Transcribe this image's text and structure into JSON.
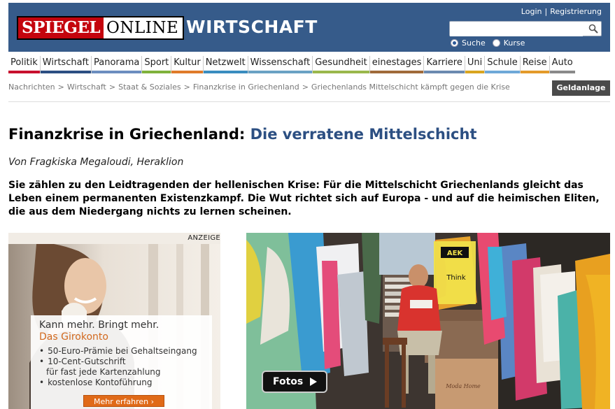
{
  "header": {
    "logo_word1": "SPIEGEL",
    "logo_word2": "ONLINE",
    "section": "WIRTSCHAFT",
    "login": "Login",
    "separator": "|",
    "register": "Registrierung",
    "search_placeholder": "",
    "radio_suche": "Suche",
    "radio_kurse": "Kurse"
  },
  "nav": [
    {
      "label": "Politik",
      "color": "#c8102e"
    },
    {
      "label": "Wirtschaft",
      "color": "#2c4f82"
    },
    {
      "label": "Panorama",
      "color": "#6c8ebf"
    },
    {
      "label": "Sport",
      "color": "#7fb23c"
    },
    {
      "label": "Kultur",
      "color": "#e07b2a"
    },
    {
      "label": "Netzwelt",
      "color": "#3a8dbf"
    },
    {
      "label": "Wissenschaft",
      "color": "#6aa2c4"
    },
    {
      "label": "Gesundheit",
      "color": "#9ab84c"
    },
    {
      "label": "einestages",
      "color": "#a06a3a"
    },
    {
      "label": "Karriere",
      "color": "#6b8ab0"
    },
    {
      "label": "Uni",
      "color": "#d9a520"
    },
    {
      "label": "Schule",
      "color": "#6ea8d8"
    },
    {
      "label": "Reise",
      "color": "#e39a2a"
    },
    {
      "label": "Auto",
      "color": "#8a8a8a"
    }
  ],
  "breadcrumb": [
    "Nachrichten",
    "Wirtschaft",
    "Staat & Soziales",
    "Finanzkrise in Griechenland",
    "Griechenlands Mittelschicht kämpft gegen die Krise"
  ],
  "breadcrumb_sep": ">",
  "geldanlage": "Geldanlage",
  "article": {
    "kicker": "Finanzkrise in Griechenland:",
    "title": "Die verratene Mittelschicht",
    "author": "Von Fragkiska Megaloudi, Heraklion",
    "teaser": "Sie zählen zu den Leidtragenden der hellenischen Krise: Für die Mittelschicht Griechenlands gleicht das Leben einem permanenten Existenzkampf. Die Wut richtet sich auf Europa - und auf die heimischen Eliten, die aus dem Niedergang nichts zu lernen scheinen."
  },
  "ad": {
    "label": "ANZEIGE",
    "headline": "Kann mehr. Bringt mehr.",
    "product": "Das Girokonto",
    "bullets": [
      "50-Euro-Prämie bei Gehaltseingang",
      "10-Cent-Gutschrift",
      "für fast jede Kartenzahlung",
      "kostenlose Kontoführung"
    ],
    "cta": "Mehr erfahren ›"
  },
  "photo": {
    "button": "Fotos",
    "shirt_text": "AEK",
    "shirt_text2": "Think",
    "bag_text": "Moda Home"
  }
}
